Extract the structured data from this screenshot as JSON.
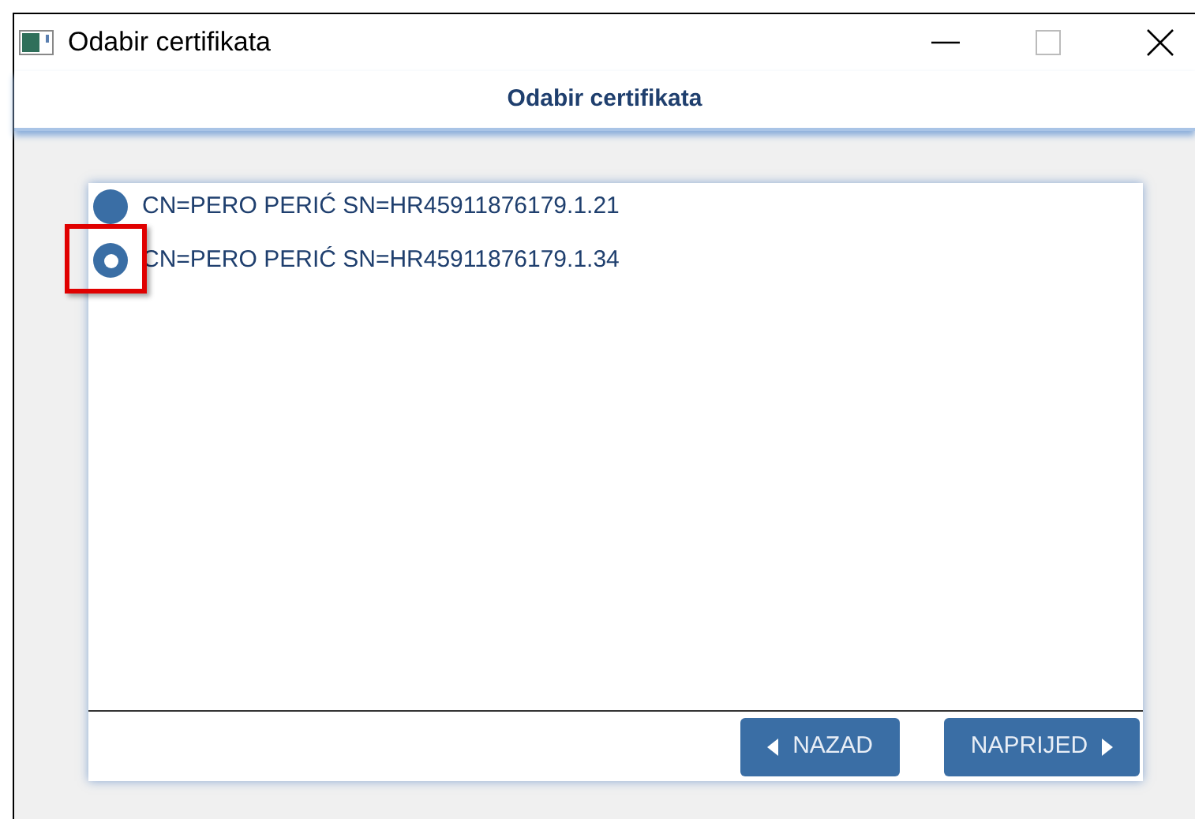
{
  "window": {
    "title": "Odabir certifikata"
  },
  "header": {
    "title": "Odabir certifikata"
  },
  "certificates": [
    {
      "label": "CN=PERO PERIĆ SN=HR45911876179.1.21",
      "selected": false,
      "highlighted": false
    },
    {
      "label": "CN=PERO PERIĆ SN=HR45911876179.1.34",
      "selected": true,
      "highlighted": true
    }
  ],
  "buttons": [
    {
      "label": "NAZAD",
      "kind": "back"
    },
    {
      "label": "NAPRIJED",
      "kind": "forward"
    }
  ]
}
